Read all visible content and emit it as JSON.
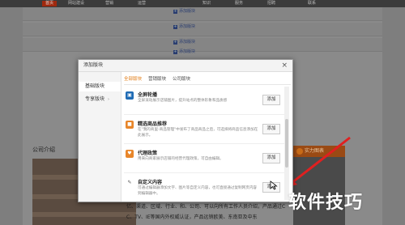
{
  "background": {
    "topnav": {
      "items": [
        "首页",
        "网站建设",
        "营销",
        "运营",
        "知识",
        "服务",
        "招聘",
        "联系"
      ]
    },
    "add_block_label": "添加版块",
    "company_intro_title": "公司介绍",
    "cta_label": "实力图表",
    "footer_texts": [
      "亿、渠道、区域、行业、和、公司、可以向所有工作人员介绍，产品通过C",
      "C、TV、IE等国内外权威认证，产品远销欧美、东南亚及中东"
    ]
  },
  "modal": {
    "title": "添加版块",
    "close": "×",
    "sidebar": [
      {
        "label": "基础版块",
        "active": true
      },
      {
        "label": "专享版块",
        "caret": "›",
        "active": false
      }
    ],
    "tabs": [
      {
        "label": "全部版块",
        "active": true
      },
      {
        "label": "营销版块",
        "active": false
      },
      {
        "label": "公司版块",
        "active": false
      }
    ],
    "blocks": [
      {
        "name": "全屏轮播",
        "desc": "全屏滚动展示店铺图片，提升站点的整体形象和品质感",
        "button": "添加",
        "icon": "image-icon",
        "color": "#1f6bb5"
      },
      {
        "name": "精选商品推荐",
        "desc": "在\"我的商里-商品管理\"中发布了商品商品之后，可选择将商品信息添加在此展示。",
        "button": "添加",
        "icon": "box-icon",
        "color": "#e8862a"
      },
      {
        "name": "代理政策",
        "desc": "用来向商家展示店铺的经营代理政策，可自由编辑。",
        "button": "添加",
        "icon": "heart-icon",
        "color": "#e8862a"
      },
      {
        "name": "自定义内容",
        "desc": "可通过编辑器添加文字、图片等自定义内容，也可直接通过复制网页内容到编辑器中。",
        "button": "添加",
        "icon": "pencil-icon",
        "color": "#ffffff"
      }
    ]
  },
  "watermark": "软件技巧",
  "colors": {
    "accent": "#e07a12",
    "nav_active": "#a0290e",
    "arrow": "#e02020"
  }
}
